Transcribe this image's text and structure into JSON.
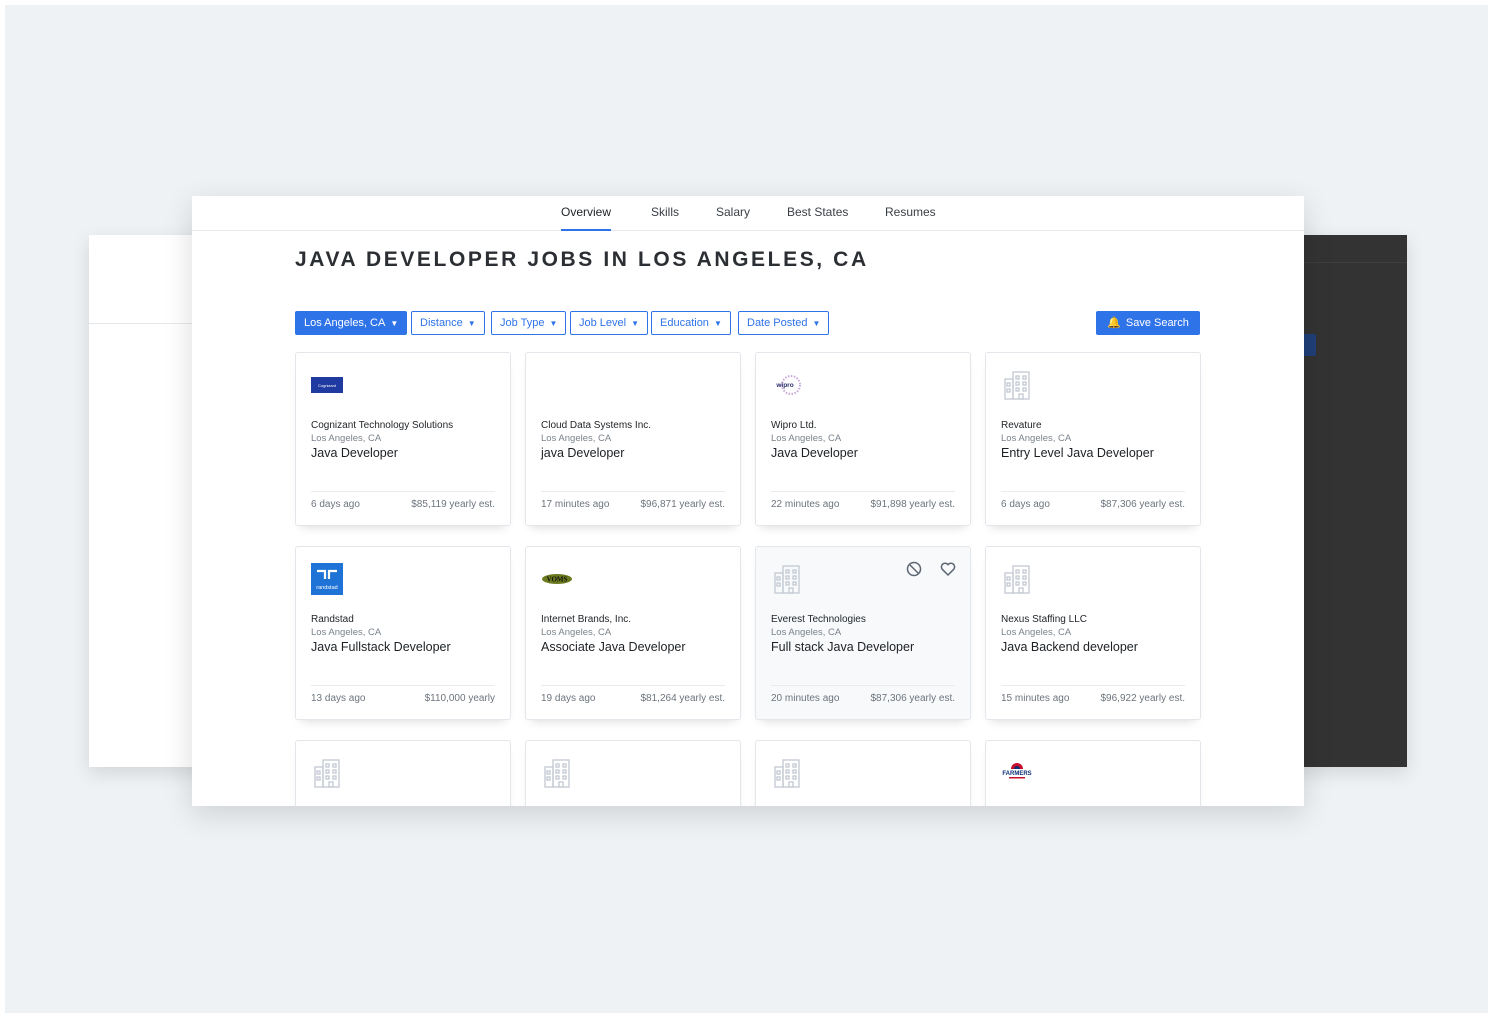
{
  "nav": {
    "tabs": [
      {
        "label": "Overview",
        "active": true
      },
      {
        "label": "Skills"
      },
      {
        "label": "Salary"
      },
      {
        "label": "Best States"
      },
      {
        "label": "Resumes"
      }
    ]
  },
  "page": {
    "title": "JAVA DEVELOPER JOBS IN LOS ANGELES, CA"
  },
  "filters": [
    {
      "label": "Los Angeles, CA",
      "active": true
    },
    {
      "label": "Distance"
    },
    {
      "label": "Job Type"
    },
    {
      "label": "Job Level"
    },
    {
      "label": "Education"
    },
    {
      "label": "Date Posted"
    }
  ],
  "save_search": {
    "label": "Save Search"
  },
  "jobs": [
    {
      "company": "Cognizant Technology Solutions",
      "location": "Los Angeles, CA",
      "title": "Java Developer",
      "posted": "6 days ago",
      "salary": "$85,119 yearly est.",
      "logo": "cognizant",
      "logo_text": "Cognizant"
    },
    {
      "company": "Cloud Data Systems Inc.",
      "location": "Los Angeles, CA",
      "title": "java Developer",
      "posted": "17 minutes ago",
      "salary": "$96,871 yearly est.",
      "logo": "none"
    },
    {
      "company": "Wipro Ltd.",
      "location": "Los Angeles, CA",
      "title": "Java Developer",
      "posted": "22 minutes ago",
      "salary": "$91,898 yearly est.",
      "logo": "wipro",
      "logo_text": "wipro"
    },
    {
      "company": "Revature",
      "location": "Los Angeles, CA",
      "title": "Entry Level Java Developer",
      "posted": "6 days ago",
      "salary": "$87,306 yearly est.",
      "logo": "building"
    },
    {
      "company": "Randstad",
      "location": "Los Angeles, CA",
      "title": "Java Fullstack Developer",
      "posted": "13 days ago",
      "salary": "$110,000 yearly",
      "logo": "randstad",
      "logo_text": "randstad"
    },
    {
      "company": "Internet Brands, Inc.",
      "location": "Los Angeles, CA",
      "title": "Associate Java Developer",
      "posted": "19 days ago",
      "salary": "$81,264 yearly est.",
      "logo": "internet-brands",
      "logo_text": "VOMS"
    },
    {
      "company": "Everest Technologies",
      "location": "Los Angeles, CA",
      "title": "Full stack Java Developer",
      "posted": "20 minutes ago",
      "salary": "$87,306 yearly est.",
      "logo": "building",
      "hover": true
    },
    {
      "company": "Nexus Staffing LLC",
      "location": "Los Angeles, CA",
      "title": "Java Backend developer",
      "posted": "15 minutes ago",
      "salary": "$96,922 yearly est.",
      "logo": "building"
    },
    {
      "logo": "building"
    },
    {
      "logo": "building"
    },
    {
      "logo": "building"
    },
    {
      "logo": "farmers",
      "logo_text": "FARMERS"
    }
  ],
  "icons": {
    "hide": "block-icon",
    "save": "heart-icon",
    "placeholder_logo": "building-icon",
    "dropdown": "chevron-down-icon",
    "bell": "bell-icon"
  },
  "colors": {
    "accent": "#2f73e8",
    "background": "#eff2f5",
    "dark_panel": "#333333"
  }
}
